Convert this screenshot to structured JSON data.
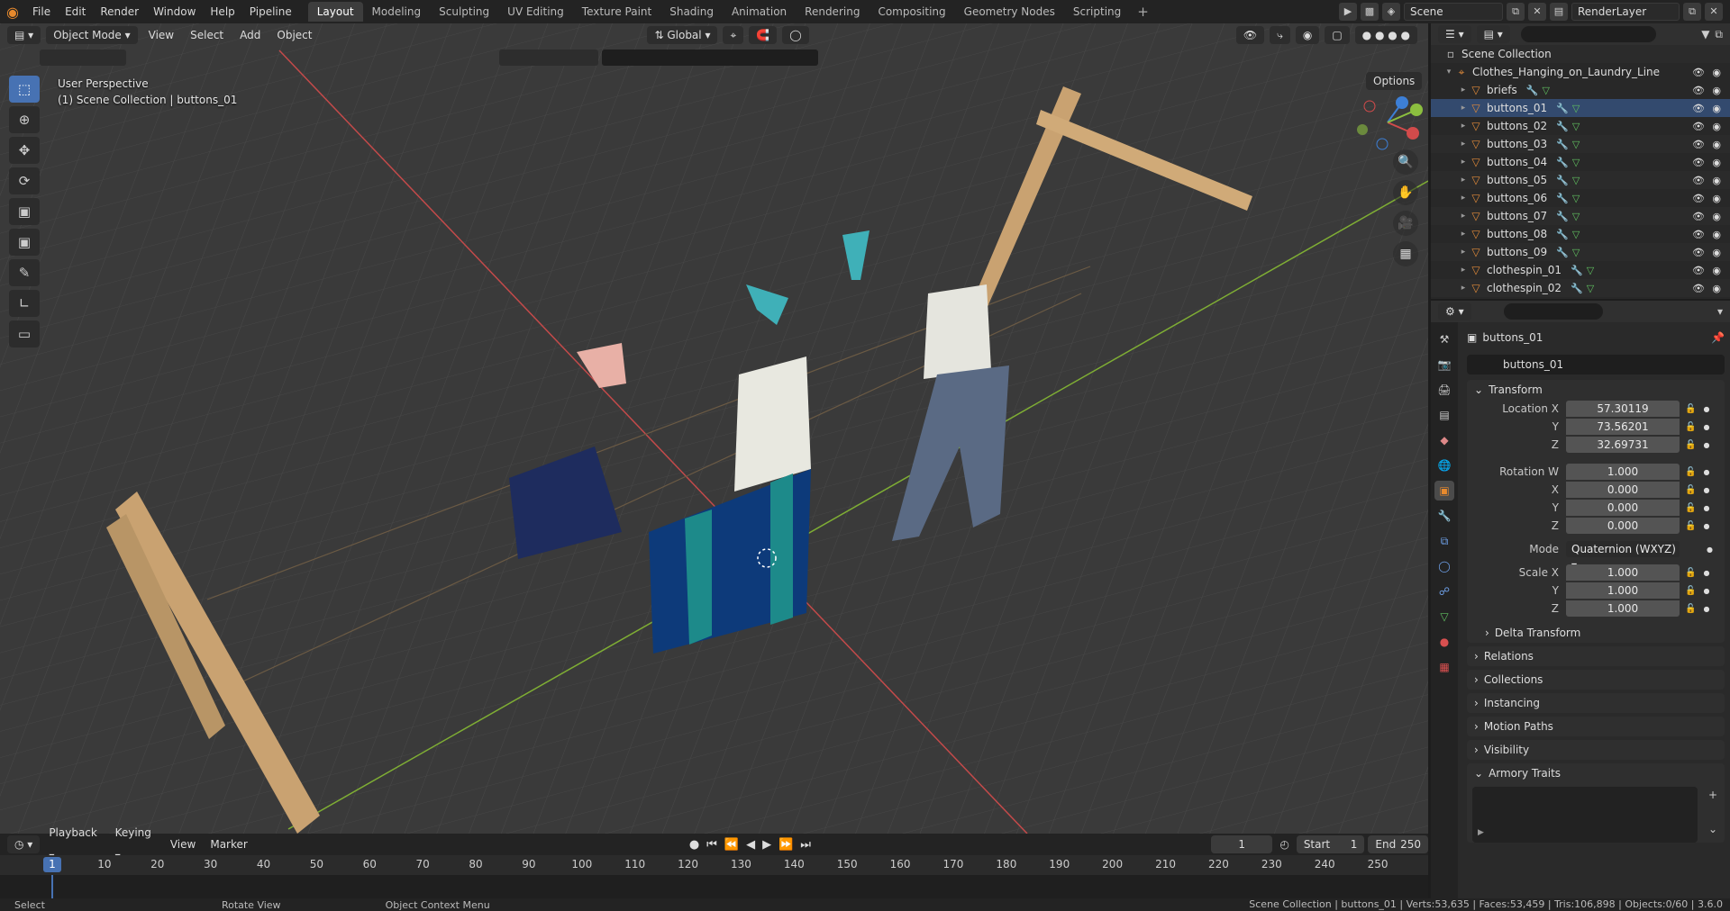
{
  "app": {
    "menus": [
      "File",
      "Edit",
      "Render",
      "Window",
      "Help",
      "Pipeline"
    ],
    "workspaces": [
      "Layout",
      "Modeling",
      "Sculpting",
      "UV Editing",
      "Texture Paint",
      "Shading",
      "Animation",
      "Rendering",
      "Compositing",
      "Geometry Nodes",
      "Scripting"
    ],
    "active_workspace": "Layout",
    "scene": "Scene",
    "view_layer": "RenderLayer"
  },
  "viewport": {
    "mode": "Object Mode",
    "menus": [
      "View",
      "Select",
      "Add",
      "Object"
    ],
    "transform_orientation": "Global",
    "options": "Options",
    "perspective_label": "User Perspective",
    "context_label": "(1) Scene Collection | buttons_01"
  },
  "outliner": {
    "root": "Scene Collection",
    "collection": "Clothes_Hanging_on_Laundry_Line",
    "items": [
      "briefs",
      "buttons_01",
      "buttons_02",
      "buttons_03",
      "buttons_04",
      "buttons_05",
      "buttons_06",
      "buttons_07",
      "buttons_08",
      "buttons_09",
      "clothespin_01",
      "clothespin_02"
    ]
  },
  "properties": {
    "object_name": "buttons_01",
    "name_field": "buttons_01",
    "transform_label": "Transform",
    "location": {
      "label": "Location X",
      "x": "57.30119",
      "y": "73.56201",
      "z": "32.69731"
    },
    "rotation": {
      "label": "Rotation W",
      "w": "1.000",
      "x": "0.000",
      "y": "0.000",
      "z": "0.000"
    },
    "mode": {
      "label": "Mode",
      "value": "Quaternion (WXYZ)"
    },
    "scale": {
      "label": "Scale X",
      "x": "1.000",
      "y": "1.000",
      "z": "1.000"
    },
    "axis_labels": {
      "x": "X",
      "y": "Y",
      "z": "Z"
    },
    "delta_transform": "Delta Transform",
    "sections": [
      "Relations",
      "Collections",
      "Instancing",
      "Motion Paths",
      "Visibility"
    ],
    "armory_traits": "Armory Traits"
  },
  "timeline": {
    "menus": [
      "Playback",
      "Keying",
      "View",
      "Marker"
    ],
    "current_frame": "1",
    "start_label": "Start",
    "start": "1",
    "end_label": "End",
    "end": "250",
    "ruler": [
      "10",
      "20",
      "30",
      "40",
      "50",
      "60",
      "70",
      "80",
      "90",
      "100",
      "110",
      "120",
      "130",
      "140",
      "150",
      "160",
      "170",
      "180",
      "190",
      "200",
      "210",
      "220",
      "230",
      "240",
      "250"
    ]
  },
  "statusbar": {
    "select": "Select",
    "rotate": "Rotate View",
    "context_menu": "Object Context Menu",
    "stats": "Scene Collection | buttons_01 | Verts:53,635 | Faces:53,459 | Tris:106,898 | Objects:0/60 | 3.6.0"
  },
  "colors": {
    "accent": "#4772b3",
    "object_orange": "#e08a3a",
    "mesh_green": "#60c060",
    "axis_x": "#d24b4b",
    "axis_y": "#8cbf3f",
    "axis_z": "#3d7fd6"
  }
}
